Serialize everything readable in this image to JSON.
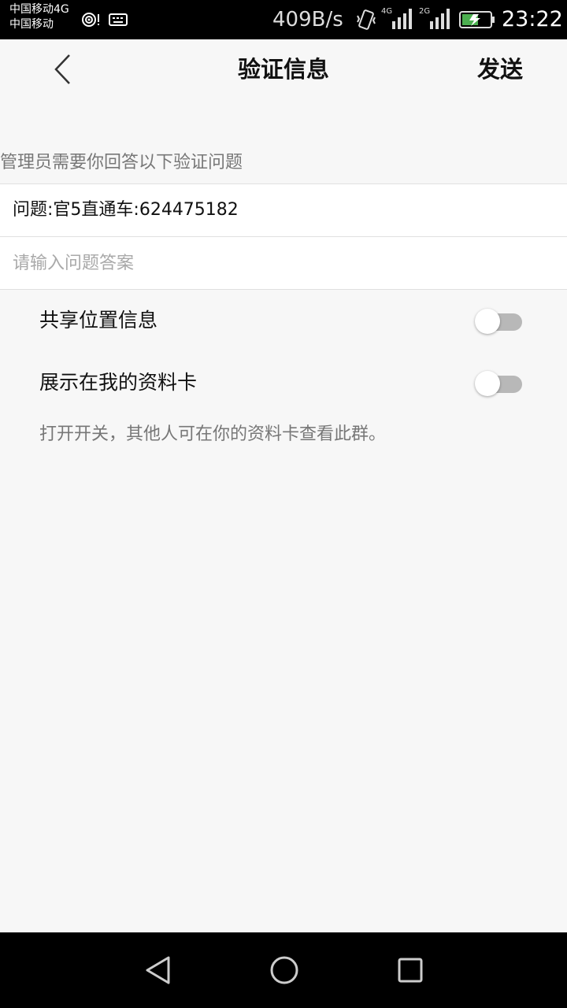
{
  "status_bar": {
    "carrier_1": "中国移动4G",
    "carrier_2": "中国移动",
    "speed": "409B/s",
    "network_1": "4G",
    "network_2": "2G",
    "time": "23:22",
    "icons": [
      "hotspot-icon",
      "keyboard-icon",
      "vibrate-icon",
      "signal-icon",
      "battery-charging-icon"
    ]
  },
  "header": {
    "title": "验证信息",
    "send_label": "发送",
    "back_icon": "chevron-left-icon"
  },
  "form": {
    "instructions": "管理员需要你回答以下验证问题",
    "question": "问题:官5直通车:624475182",
    "answer_placeholder": "请输入问题答案",
    "answer_value": ""
  },
  "settings": [
    {
      "label": "共享位置信息",
      "enabled": false
    },
    {
      "label": "展示在我的资料卡",
      "enabled": false
    }
  ],
  "note": "打开开关，其他人可在你的资料卡查看此群。",
  "nav_bar": {
    "icons": [
      "back-triangle-icon",
      "home-circle-icon",
      "recents-square-icon"
    ]
  },
  "colors": {
    "background": "#f7f7f7",
    "toggle_off": "#b8b8b8",
    "status_bar": "#000000",
    "battery": "#4caf50"
  }
}
